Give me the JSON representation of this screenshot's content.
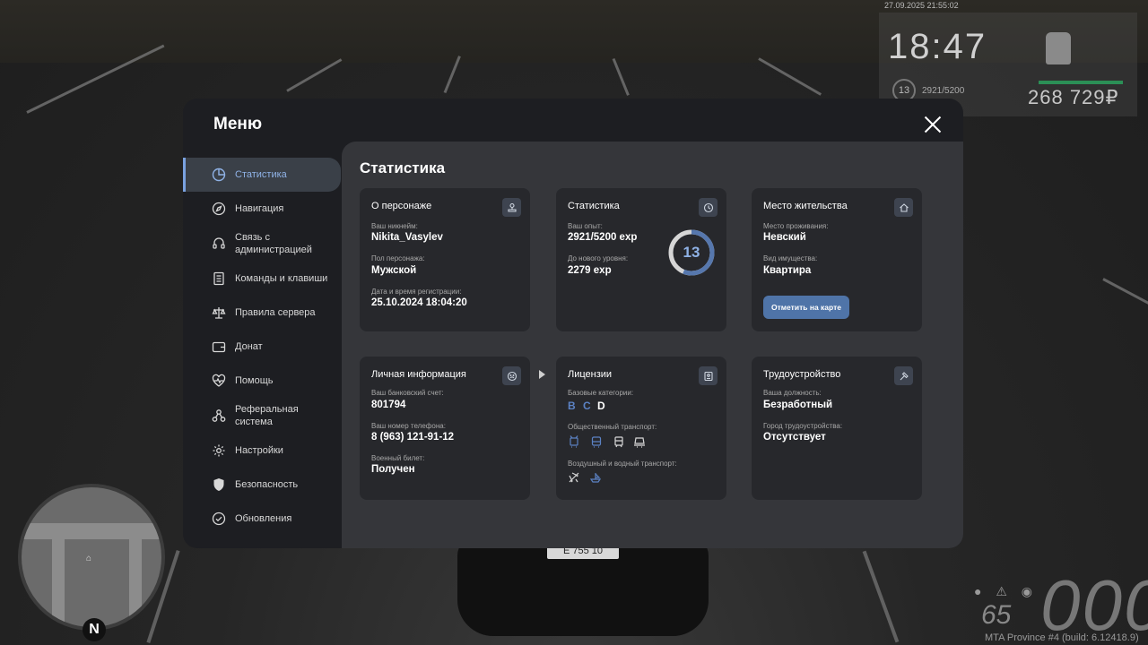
{
  "hud": {
    "datetime": "27.09.2025 21:55:02",
    "time": "18:47",
    "level": "13",
    "exp": "2921/5200",
    "money": "268 729₽",
    "speed": "000",
    "fuel": "65",
    "build": "MTA Province #4 (build: 6.12418.9)",
    "plate": "Е 755 10",
    "compass": "N"
  },
  "menu": {
    "title": "Меню",
    "sidebar": [
      {
        "label": "Статистика",
        "icon": "pie-chart-icon",
        "active": true
      },
      {
        "label": "Навигация",
        "icon": "compass-icon"
      },
      {
        "label": "Связь с администрацией",
        "icon": "headset-icon"
      },
      {
        "label": "Команды и клавиши",
        "icon": "document-icon"
      },
      {
        "label": "Правила сервера",
        "icon": "scales-icon"
      },
      {
        "label": "Донат",
        "icon": "wallet-icon"
      },
      {
        "label": "Помощь",
        "icon": "heart-pulse-icon"
      },
      {
        "label": "Реферальная система",
        "icon": "network-icon"
      },
      {
        "label": "Настройки",
        "icon": "gear-icon"
      },
      {
        "label": "Безопасность",
        "icon": "shield-icon"
      },
      {
        "label": "Обновления",
        "icon": "check-circle-icon"
      }
    ],
    "content_title": "Статистика",
    "character": {
      "title": "О персонаже",
      "nick_label": "Ваш никнейм:",
      "nick": "Nikita_Vasylev",
      "gender_label": "Пол персонажа:",
      "gender": "Мужской",
      "reg_label": "Дата и время регистрации:",
      "reg": "25.10.2024 18:04:20"
    },
    "stats": {
      "title": "Статистика",
      "exp_label": "Ваш опыт:",
      "exp": "2921/5200 exp",
      "next_label": "До нового уровня:",
      "next": "2279 exp",
      "level": "13",
      "progress": 0.5617
    },
    "residence": {
      "title": "Место жительства",
      "place_label": "Место проживания:",
      "place": "Невский",
      "prop_label": "Вид имущества:",
      "prop": "Квартира",
      "button": "Отметить на карте"
    },
    "personal": {
      "title": "Личная информация",
      "bank_label": "Ваш банковский счет:",
      "bank": "801794",
      "phone_label": "Ваш номер телефона:",
      "phone": "8 (963) 121-91-12",
      "military_label": "Военный билет:",
      "military": "Получен"
    },
    "licenses": {
      "title": "Лицензии",
      "base_label": "Базовые категории:",
      "categories": [
        {
          "letter": "B",
          "color": "#5b82c4"
        },
        {
          "letter": "C",
          "color": "#5b82c4"
        },
        {
          "letter": "D",
          "color": "#ffffff"
        }
      ],
      "public_label": "Общественный транспорт:",
      "air_label": "Воздушный и водный транспорт:"
    },
    "employment": {
      "title": "Трудоустройство",
      "position_label": "Ваша должность:",
      "position": "Безработный",
      "city_label": "Город трудоустройства:",
      "city": "Отсутствует"
    }
  },
  "colors": {
    "accent": "#8fb2e6",
    "button": "#4f74a8",
    "card": "#27282c",
    "panel": "#35363a",
    "sidebar": "#1d1e22"
  }
}
